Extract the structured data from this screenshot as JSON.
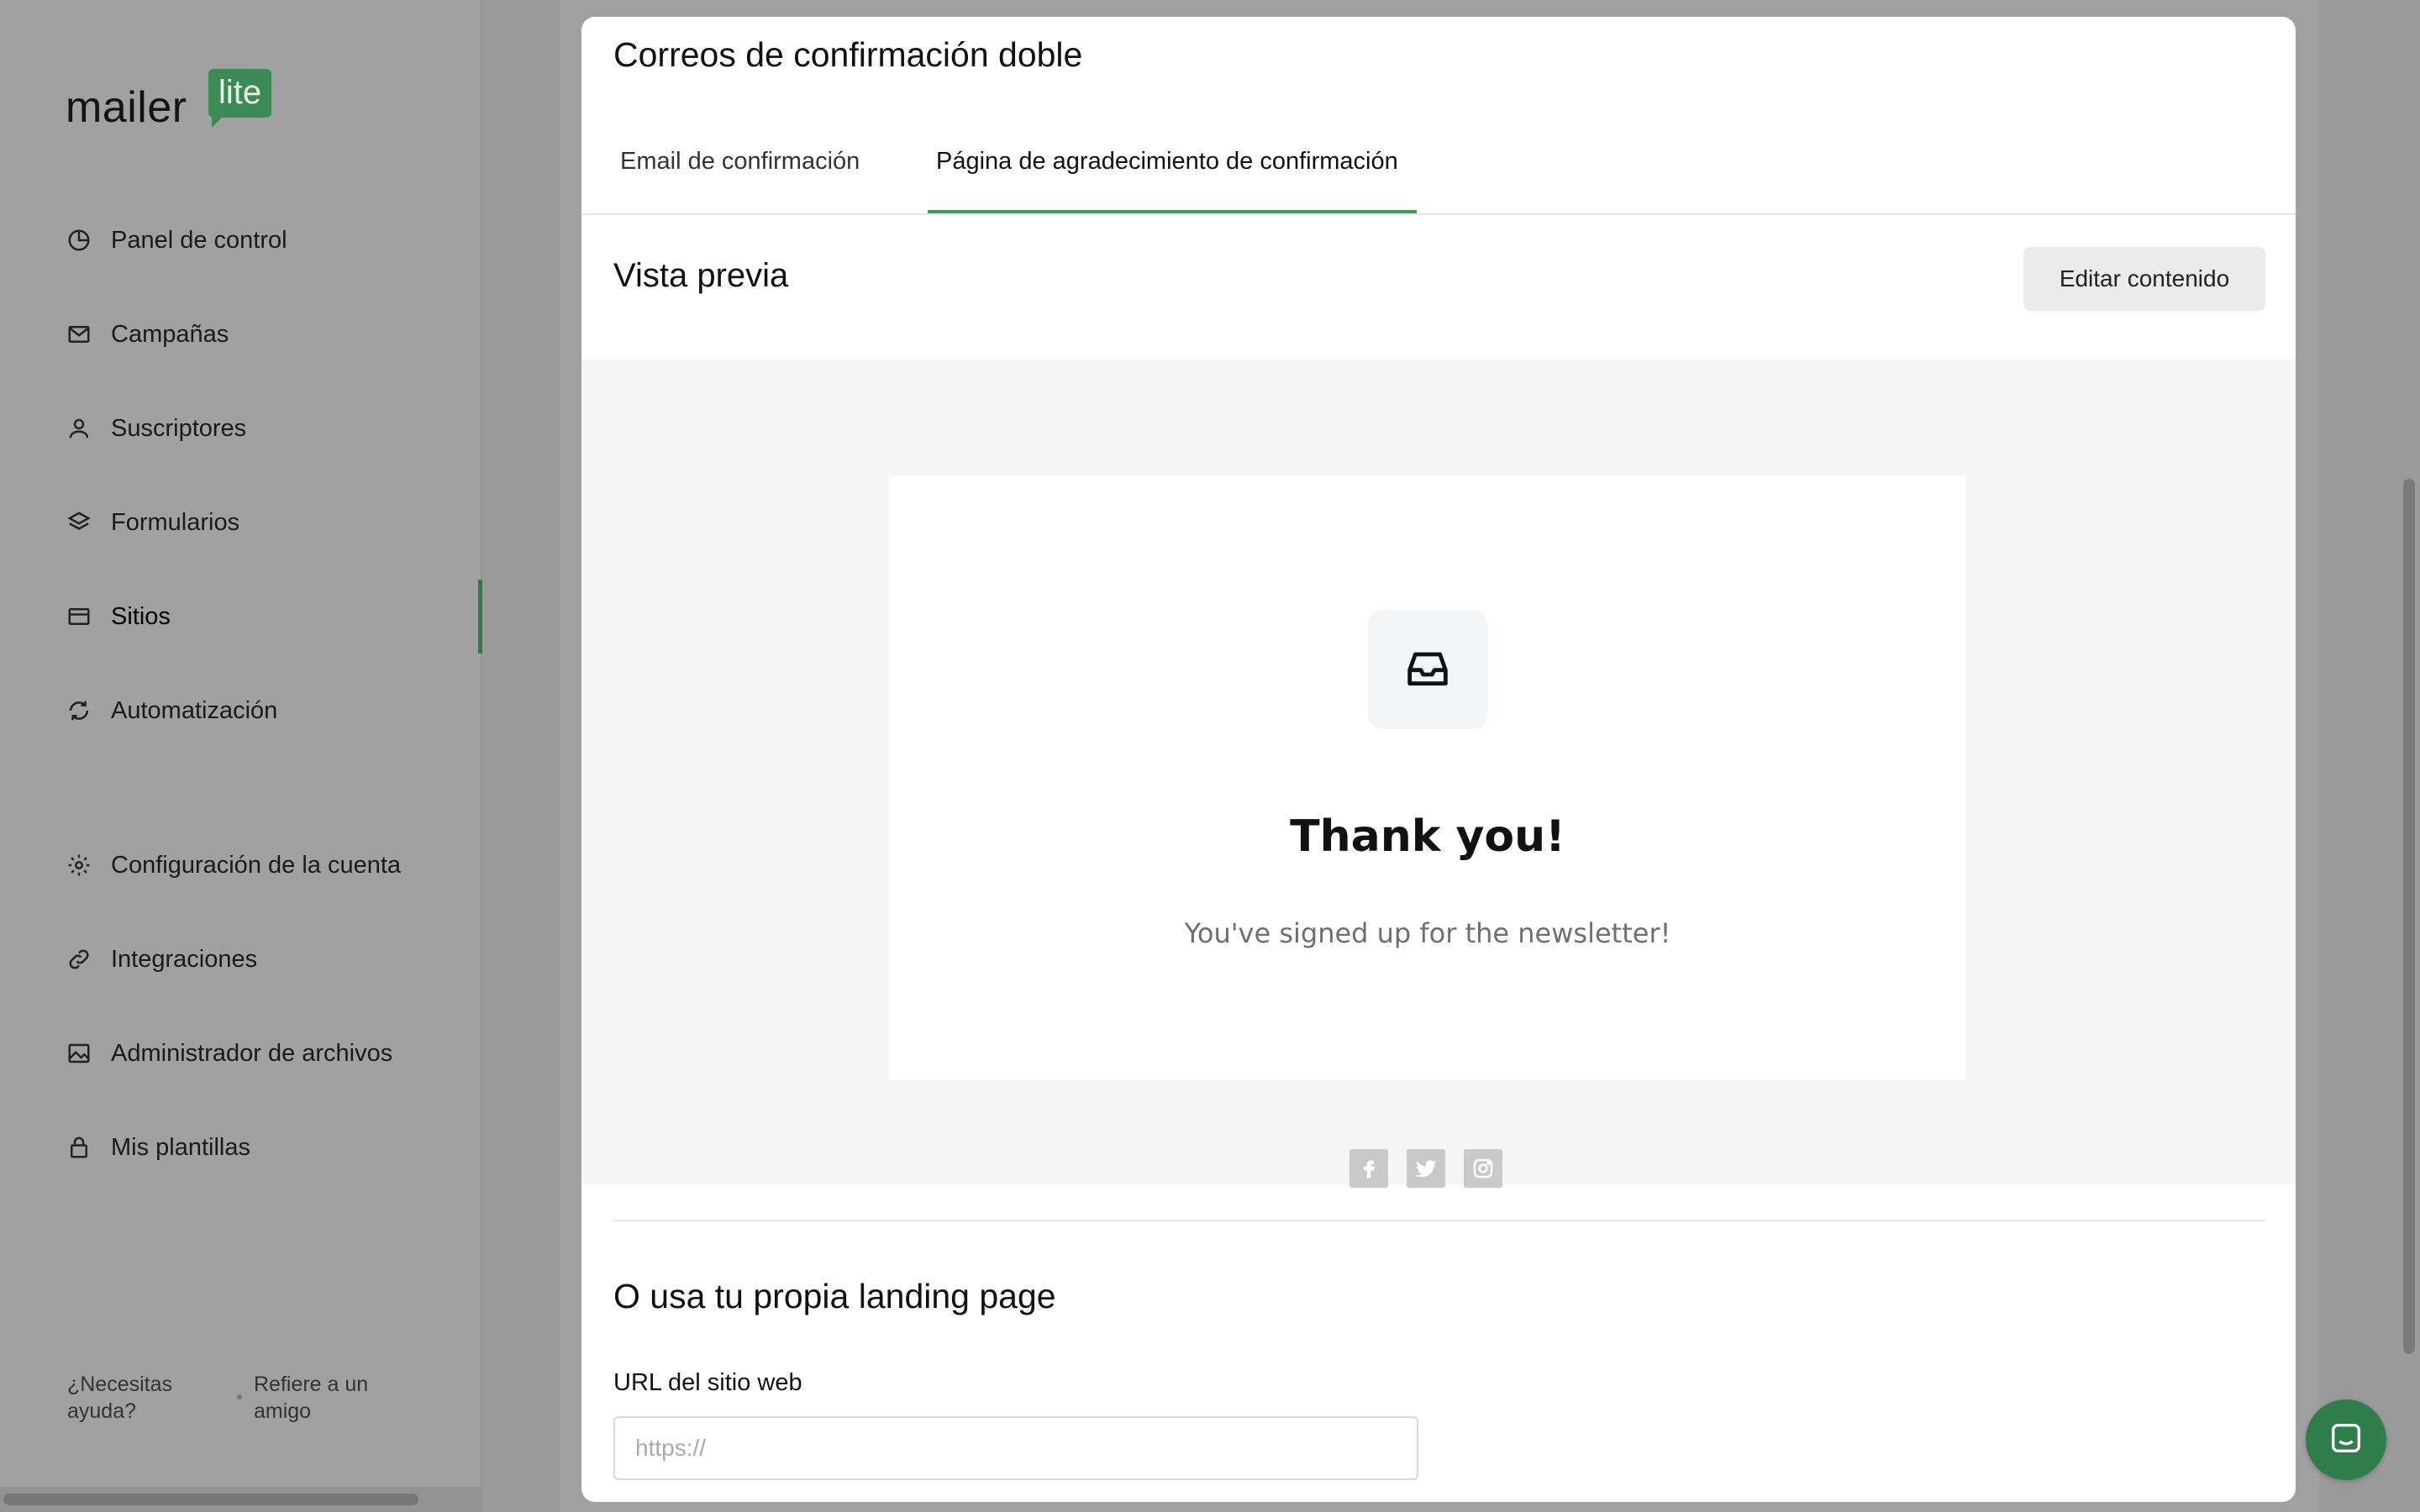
{
  "brand": {
    "word": "mailer",
    "badge": "lite",
    "accent": "#3c8b57"
  },
  "sidebar": {
    "items": [
      {
        "label": "Panel de control",
        "icon": "pie-chart-icon"
      },
      {
        "label": "Campañas",
        "icon": "mail-icon"
      },
      {
        "label": "Suscriptores",
        "icon": "user-icon"
      },
      {
        "label": "Formularios",
        "icon": "layers-icon"
      },
      {
        "label": "Sitios",
        "icon": "browser-icon",
        "active": true
      },
      {
        "label": "Automatización",
        "icon": "refresh-icon"
      },
      {
        "label": "Configuración de la cuenta",
        "icon": "gear-icon"
      },
      {
        "label": "Integraciones",
        "icon": "link-icon"
      },
      {
        "label": "Administrador de archivos",
        "icon": "image-icon"
      },
      {
        "label": "Mis plantillas",
        "icon": "lock-icon"
      }
    ],
    "help": "¿Necesitas ayuda?",
    "refer": "Refiere a un amigo"
  },
  "modal": {
    "title": "Correos de confirmación doble",
    "tabs": [
      {
        "label": "Email de confirmación"
      },
      {
        "label": "Página de agradecimiento de confirmación",
        "active": true
      }
    ],
    "preview_heading": "Vista previa",
    "edit_button": "Editar contenido",
    "preview": {
      "heading": "Thank you!",
      "subtext": "You've signed up for the newsletter!",
      "socials": [
        "facebook-icon",
        "twitter-icon",
        "instagram-icon"
      ]
    },
    "own_landing_heading": "O usa tu propia landing page",
    "url_label": "URL del sitio web",
    "url_placeholder": "https://",
    "url_value": ""
  }
}
